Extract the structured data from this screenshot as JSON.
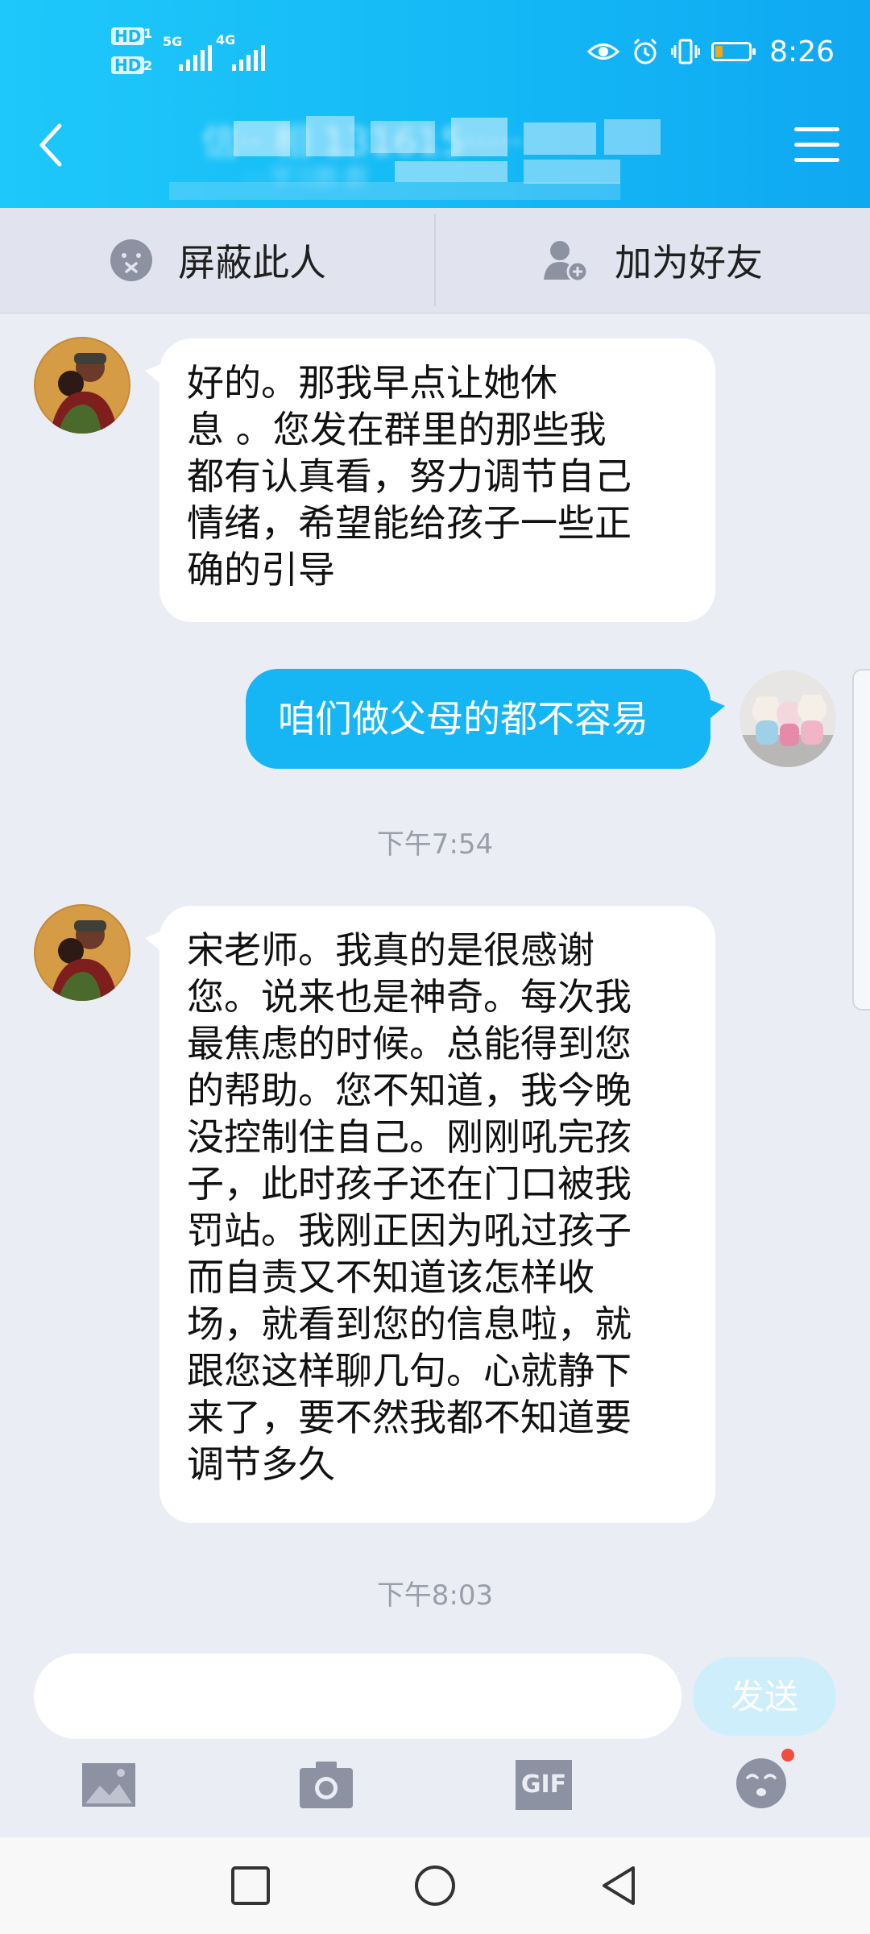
{
  "status_bar": {
    "time": "8:26",
    "sim1_label": "HD",
    "sim1_index": "1",
    "sim2_label": "HD",
    "sim2_index": "2",
    "network1": "5G",
    "network2": "4G",
    "battery_level": 0.2,
    "icons": [
      "eye-icon",
      "alarm-icon",
      "vibrate-icon",
      "battery-icon"
    ]
  },
  "header": {
    "title": "信·· 相 131615·····",
    "subtitle": "····学习群·群"
  },
  "actions": {
    "block_label": "屏蔽此人",
    "add_friend_label": "加为好友"
  },
  "messages": [
    {
      "direction": "incoming",
      "lines": [
        "好的。那我早点让她休",
        "息 。您发在群里的那些我",
        "都有认真看，努力调节自己",
        "情绪，希望能给孩子一些正",
        "确的引导"
      ]
    },
    {
      "direction": "outgoing",
      "text": "咱们做父母的都不容易"
    },
    {
      "timestamp": "下午7:54"
    },
    {
      "direction": "incoming",
      "lines": [
        "宋老师。我真的是很感谢",
        "您。说来也是神奇。每次我",
        "最焦虑的时候。总能得到您",
        "的帮助。您不知道，我今晚",
        "没控制住自己。刚刚吼完孩",
        "子，此时孩子还在门口被我",
        "罚站。我刚正因为吼过孩子",
        "而自责又不知道该怎样收",
        "场，就看到您的信息啦，就",
        "跟您这样聊几句。心就静下",
        "来了，要不然我都不知道要",
        "调节多久"
      ]
    },
    {
      "timestamp": "下午8:03"
    }
  ],
  "input": {
    "value": "",
    "placeholder": "",
    "send_label": "发送"
  },
  "toolbar": {
    "gif_label": "GIF"
  },
  "colors": {
    "header": "#14b9f5",
    "outgoing_bubble": "#16b6f4",
    "send_button_disabled": "#cfeefc",
    "background": "#ebedf5"
  }
}
